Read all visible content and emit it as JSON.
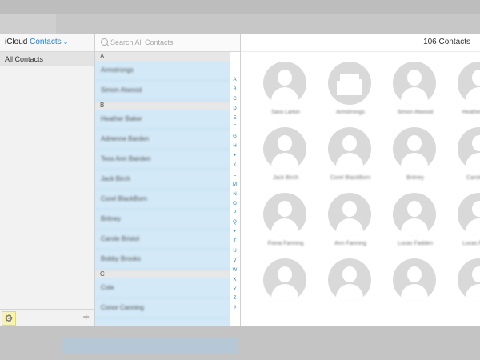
{
  "sidebar": {
    "app_word": "iCloud",
    "menu_word": "Contacts",
    "group_label": "All Contacts",
    "add_label": "+",
    "settings_label": "⚙"
  },
  "search": {
    "placeholder": "Search All Contacts"
  },
  "list": {
    "sections": [
      {
        "letter": "A",
        "contacts": [
          "Armstrongs",
          "Simon Atwood"
        ]
      },
      {
        "letter": "B",
        "contacts": [
          "Heather Baker",
          "Adrienne Barden",
          "Tess Ann Bairden",
          "Jack Birch",
          "Corel BlackBorn",
          "Britney",
          "Carole Bristol",
          "Bobby Brooks"
        ]
      },
      {
        "letter": "C",
        "contacts": [
          "Cole",
          "Conor Canning"
        ]
      }
    ],
    "index_letters": [
      "A",
      "B",
      "C",
      "D",
      "E",
      "F",
      "G",
      "H",
      "•",
      "K",
      "L",
      "M",
      "N",
      "O",
      "P",
      "Q",
      "•",
      "T",
      "U",
      "V",
      "W",
      "X",
      "Y",
      "Z",
      "#"
    ]
  },
  "cards": {
    "count_label": "106 Contacts",
    "items": [
      {
        "name": "Sara Larkin",
        "type": "person"
      },
      {
        "name": "Armstrongs",
        "type": "building"
      },
      {
        "name": "Simon Atwood",
        "type": "person"
      },
      {
        "name": "Heather Baker",
        "type": "person"
      },
      {
        "name": "Jack Birch",
        "type": "person"
      },
      {
        "name": "Corel BlackBorn",
        "type": "person"
      },
      {
        "name": "Britney",
        "type": "person"
      },
      {
        "name": "Carole Brill",
        "type": "person"
      },
      {
        "name": "Fiona Fanning",
        "type": "person"
      },
      {
        "name": "Ann Fanning",
        "type": "person"
      },
      {
        "name": "Lucas Fadden",
        "type": "person"
      },
      {
        "name": "Lucas Fadden",
        "type": "person"
      },
      {
        "name": "",
        "type": "person"
      },
      {
        "name": "",
        "type": "person"
      },
      {
        "name": "",
        "type": "person"
      },
      {
        "name": "",
        "type": "person"
      }
    ]
  }
}
